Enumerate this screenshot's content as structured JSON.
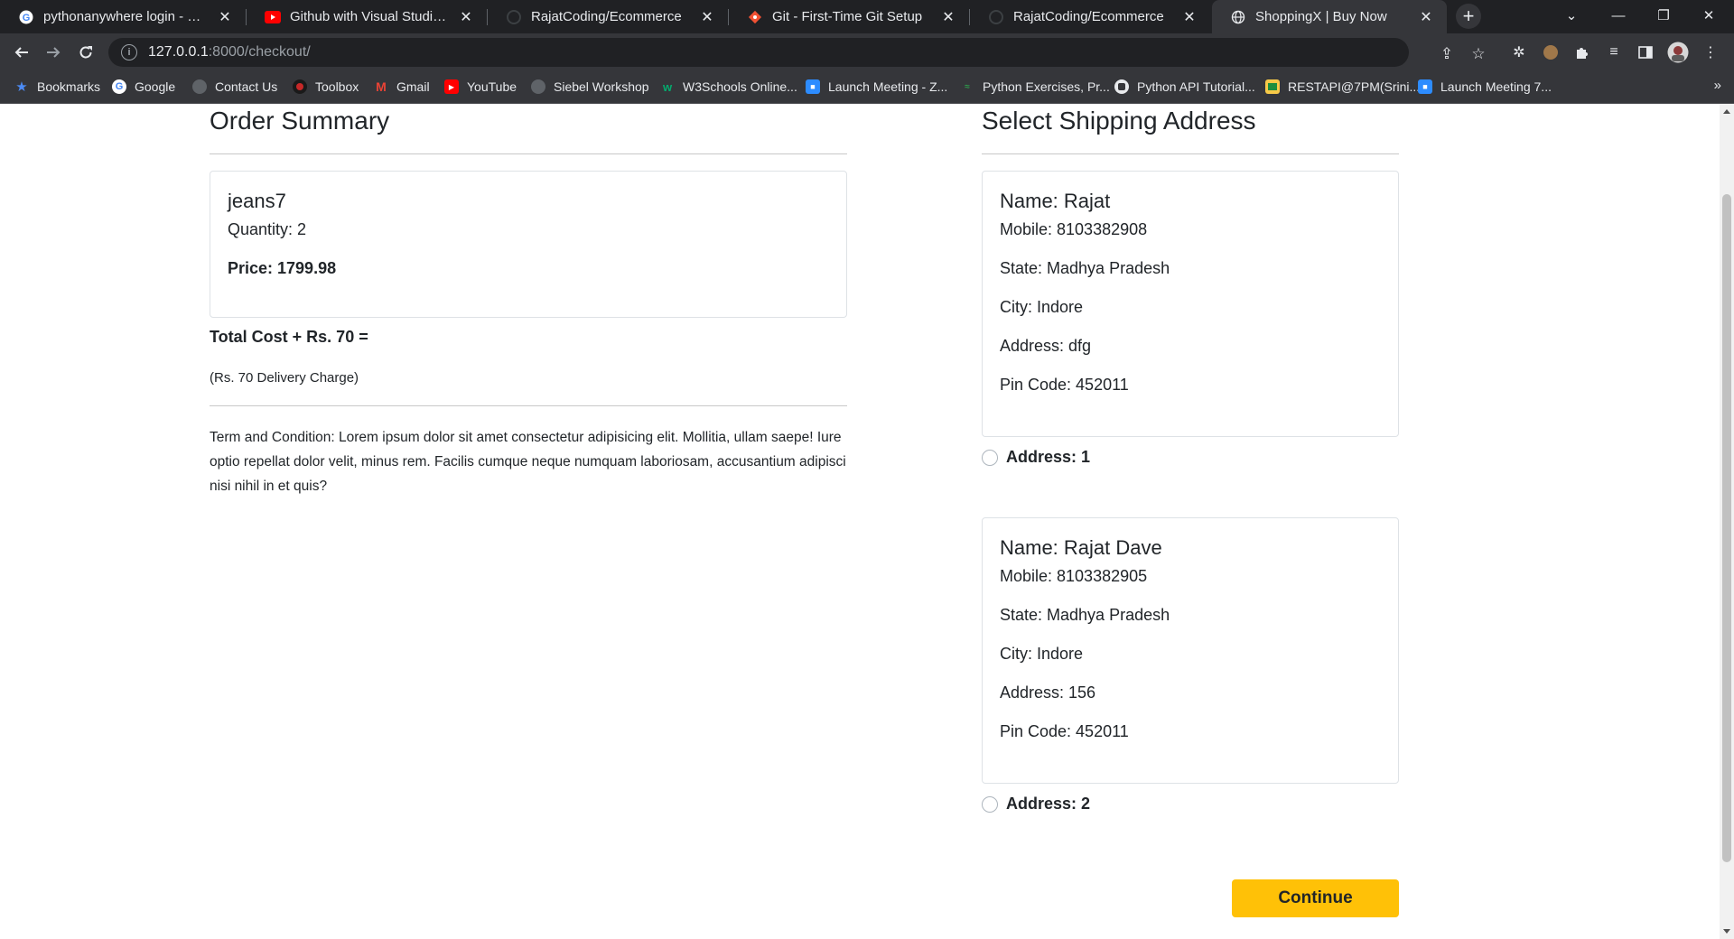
{
  "browser": {
    "tabs": [
      {
        "title": "pythonanywhere login - Google S",
        "icon": "google-icon"
      },
      {
        "title": "Github with Visual Studio Code C",
        "icon": "youtube-icon"
      },
      {
        "title": "RajatCoding/Ecommerce",
        "icon": "github-icon"
      },
      {
        "title": "Git - First-Time Git Setup",
        "icon": "git-icon"
      },
      {
        "title": "RajatCoding/Ecommerce",
        "icon": "github-icon"
      },
      {
        "title": "ShoppingX | Buy Now",
        "icon": "globe-icon",
        "active": true
      }
    ],
    "url_host": "127.0.0.1",
    "url_rest": ":8000/checkout/",
    "bookmarks": [
      {
        "label": "Bookmarks",
        "icon": "star-icon"
      },
      {
        "label": "Google",
        "icon": "google-icon"
      },
      {
        "label": "Contact Us",
        "icon": "globe-icon"
      },
      {
        "label": "Toolbox",
        "icon": "toolbox-icon"
      },
      {
        "label": "Gmail",
        "icon": "gmail-icon"
      },
      {
        "label": "YouTube",
        "icon": "youtube-icon"
      },
      {
        "label": "Siebel Workshop",
        "icon": "globe-icon"
      },
      {
        "label": "W3Schools Online...",
        "icon": "w3schools-icon"
      },
      {
        "label": "Launch Meeting - Z...",
        "icon": "zoom-icon"
      },
      {
        "label": "Python Exercises, Pr...",
        "icon": "python-exercises-icon"
      },
      {
        "label": "Python API Tutorial...",
        "icon": "python-icon"
      },
      {
        "label": "RESTAPI@7PM(Srini...",
        "icon": "classroom-icon"
      },
      {
        "label": "Launch Meeting 7...",
        "icon": "zoom-icon"
      }
    ],
    "bookmarks_more": "»"
  },
  "order": {
    "heading": "Order Summary",
    "item": {
      "name": "jeans7",
      "quantity": "Quantity: 2",
      "price": "Price: 1799.98"
    },
    "total": "Total Cost + Rs. 70 =",
    "delivery_note": "(Rs. 70 Delivery Charge)",
    "terms": "Term and Condition: Lorem ipsum dolor sit amet consectetur adipisicing elit. Mollitia, ullam saepe! Iure optio repellat dolor velit, minus rem. Facilis cumque neque numquam laboriosam, accusantium adipisci nisi nihil in et quis?"
  },
  "shipping": {
    "heading": "Select Shipping Address",
    "addresses": [
      {
        "name": "Name: Rajat",
        "mobile": "Mobile: 8103382908",
        "state": "State: Madhya Pradesh",
        "city": "City: Indore",
        "address": "Address: dfg",
        "pincode": "Pin Code: 452011",
        "radio_label": "Address: 1"
      },
      {
        "name": "Name: Rajat Dave",
        "mobile": "Mobile: 8103382905",
        "state": "State: Madhya Pradesh",
        "city": "City: Indore",
        "address": "Address: 156",
        "pincode": "Pin Code: 452011",
        "radio_label": "Address: 2"
      }
    ],
    "continue_label": "Continue"
  },
  "colors": {
    "accent": "#ffc107",
    "chrome_dark": "#202124",
    "chrome_toolbar": "#35363a"
  }
}
